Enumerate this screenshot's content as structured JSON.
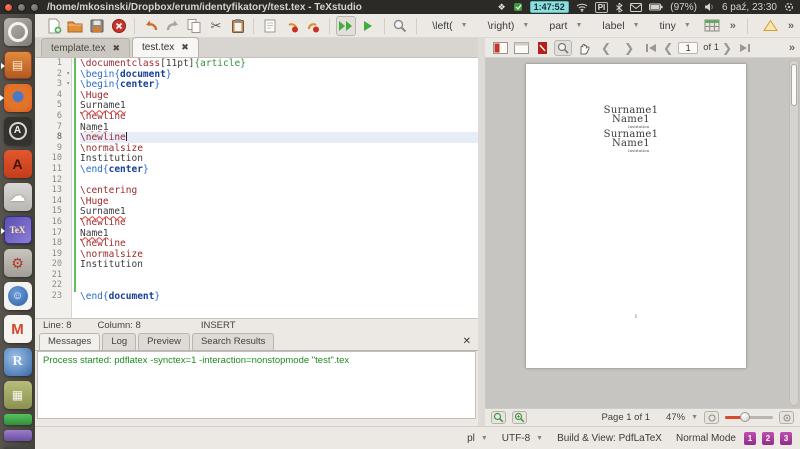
{
  "system_bar": {
    "title": "/home/mkosinski/Dropbox/erum/identyfikatory/test.tex - TeXstudio",
    "timer": "1:47:52",
    "keyboard_layout": "Pl",
    "battery": "(97%)",
    "datetime": "6 paź, 23:30"
  },
  "launcher": {
    "items": [
      {
        "id": "ubuntu-dash",
        "glyph": "",
        "running": false
      },
      {
        "id": "files",
        "glyph": "▤",
        "running": true
      },
      {
        "id": "firefox",
        "glyph": "",
        "running": true
      },
      {
        "id": "updater",
        "glyph": "A",
        "running": false
      },
      {
        "id": "installer",
        "glyph": "A",
        "running": false
      },
      {
        "id": "sheep",
        "glyph": "☁",
        "running": false
      },
      {
        "id": "texstudio",
        "glyph": "TeX",
        "running": true
      },
      {
        "id": "tools",
        "glyph": "⚙",
        "running": false
      },
      {
        "id": "chat",
        "glyph": "☺",
        "running": false
      },
      {
        "id": "gmail",
        "glyph": "M",
        "running": false
      },
      {
        "id": "rproject",
        "glyph": "R",
        "running": false
      },
      {
        "id": "photos",
        "glyph": "▦",
        "running": false
      },
      {
        "id": "mini-green",
        "glyph": "",
        "running": false,
        "mini": true
      },
      {
        "id": "mini-purple",
        "glyph": "",
        "running": false,
        "mini": true
      },
      {
        "id": "mini-dark",
        "glyph": "",
        "running": false,
        "mini": true
      }
    ]
  },
  "toolbar": {
    "dropdowns": [
      "\\left(",
      "\\right)",
      "part",
      "label",
      "tiny"
    ]
  },
  "tabs": {
    "tab1": "template.tex",
    "tab2": "test.tex"
  },
  "editor": {
    "status": {
      "line": "Line: 8",
      "column": "Column: 8",
      "mode": "INSERT"
    },
    "lines": [
      {
        "num": "1",
        "segs": [
          [
            "cmd",
            "\\documentclass"
          ],
          [
            "plain",
            "[11pt]"
          ],
          [
            "arg",
            "{article}"
          ]
        ]
      },
      {
        "num": "2",
        "fold": true,
        "segs": [
          [
            "env",
            "\\begin{"
          ],
          [
            "envname",
            "document"
          ],
          [
            "env",
            "}"
          ]
        ]
      },
      {
        "num": "3",
        "fold": true,
        "segs": [
          [
            "env",
            "\\begin{"
          ],
          [
            "envname",
            "center"
          ],
          [
            "env",
            "}"
          ]
        ]
      },
      {
        "num": "4",
        "segs": [
          [
            "cmd",
            "\\Huge"
          ]
        ]
      },
      {
        "num": "5",
        "segs": [
          [
            "misspell",
            "Surname1"
          ]
        ]
      },
      {
        "num": "6",
        "segs": [
          [
            "cmd",
            "\\newline"
          ]
        ]
      },
      {
        "num": "7",
        "segs": [
          [
            "misspell",
            "Name1"
          ]
        ]
      },
      {
        "num": "8",
        "current": true,
        "caret": true,
        "segs": [
          [
            "cmd",
            "\\newline"
          ]
        ]
      },
      {
        "num": "9",
        "segs": [
          [
            "cmd",
            "\\normalsize"
          ]
        ]
      },
      {
        "num": "10",
        "segs": [
          [
            "plain",
            "Institution"
          ]
        ]
      },
      {
        "num": "11",
        "segs": [
          [
            "env",
            "\\end{"
          ],
          [
            "envname",
            "center"
          ],
          [
            "env",
            "}"
          ]
        ]
      },
      {
        "num": "12",
        "segs": []
      },
      {
        "num": "13",
        "segs": [
          [
            "cmd",
            "\\centering"
          ]
        ]
      },
      {
        "num": "14",
        "segs": [
          [
            "cmd",
            "\\Huge"
          ]
        ]
      },
      {
        "num": "15",
        "segs": [
          [
            "misspell",
            "Surname1"
          ]
        ]
      },
      {
        "num": "16",
        "segs": [
          [
            "cmd",
            "\\newline"
          ]
        ]
      },
      {
        "num": "17",
        "segs": [
          [
            "misspell",
            "Name1"
          ]
        ]
      },
      {
        "num": "18",
        "segs": [
          [
            "cmd",
            "\\newline"
          ]
        ]
      },
      {
        "num": "19",
        "segs": [
          [
            "cmd",
            "\\normalsize"
          ]
        ]
      },
      {
        "num": "20",
        "segs": [
          [
            "plain",
            "Institution"
          ]
        ]
      },
      {
        "num": "21",
        "segs": []
      },
      {
        "num": "22",
        "segs": []
      },
      {
        "num": "23",
        "segs": [
          [
            "env",
            "\\end{"
          ],
          [
            "envname",
            "document"
          ],
          [
            "env",
            "}"
          ]
        ]
      }
    ]
  },
  "messages": {
    "tabs": [
      "Messages",
      "Log",
      "Preview",
      "Search Results"
    ],
    "close": "✕",
    "process_text": "Process started: pdflatex -synctex=1 -interaction=nonstopmode \"test\".tex"
  },
  "pdf": {
    "page_field": "1",
    "page_field_suffix": "of 1",
    "doc": {
      "surname": "Surname1",
      "name": "Name1",
      "institution": "Institution",
      "page_number": "1"
    },
    "status": {
      "page": "Page 1 of 1",
      "zoom": "47%"
    }
  },
  "status_bar": {
    "language": "pl",
    "encoding": "UTF-8",
    "build": "Build & View: PdfLaTeX",
    "mode": "Normal Mode",
    "bookmarks": [
      "1",
      "2",
      "3"
    ]
  }
}
